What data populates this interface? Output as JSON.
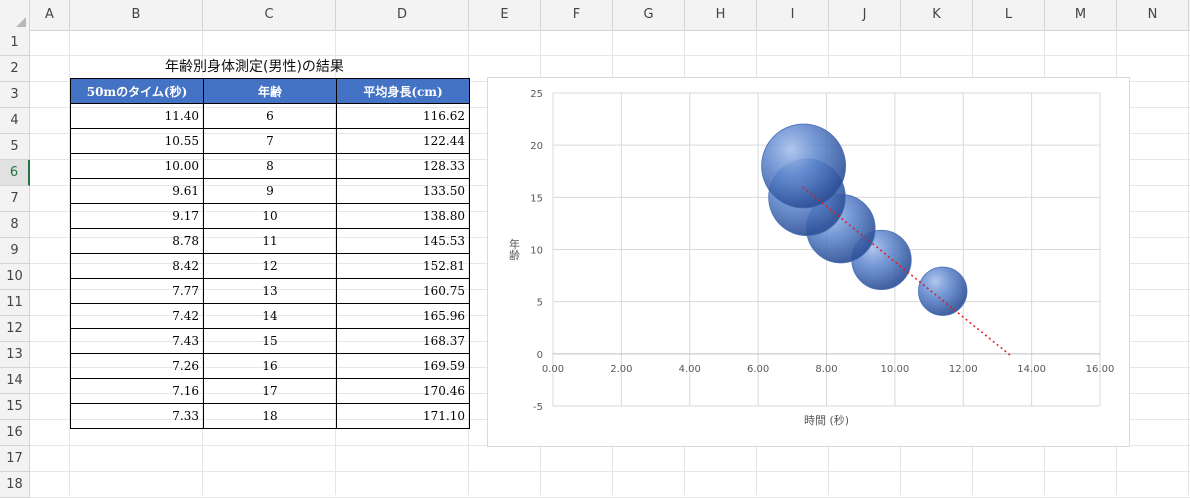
{
  "sheet": {
    "columns": [
      "A",
      "B",
      "C",
      "D",
      "E",
      "F",
      "G",
      "H",
      "I",
      "J",
      "K",
      "L",
      "M",
      "N"
    ],
    "rows": [
      "1",
      "2",
      "3",
      "4",
      "5",
      "6",
      "7",
      "8",
      "9",
      "10",
      "11",
      "12",
      "13",
      "14",
      "15",
      "16",
      "17",
      "18"
    ],
    "selected_row": "6"
  },
  "table": {
    "title": "年齢別身体測定(男性)の結果",
    "headers": [
      "50mのタイム(秒)",
      "年齢",
      "平均身長(cm)"
    ],
    "rows": [
      {
        "time": "11.40",
        "age": "6",
        "height": "116.62"
      },
      {
        "time": "10.55",
        "age": "7",
        "height": "122.44"
      },
      {
        "time": "10.00",
        "age": "8",
        "height": "128.33"
      },
      {
        "time": "9.61",
        "age": "9",
        "height": "133.50"
      },
      {
        "time": "9.17",
        "age": "10",
        "height": "138.80"
      },
      {
        "time": "8.78",
        "age": "11",
        "height": "145.53"
      },
      {
        "time": "8.42",
        "age": "12",
        "height": "152.81"
      },
      {
        "time": "7.77",
        "age": "13",
        "height": "160.75"
      },
      {
        "time": "7.42",
        "age": "14",
        "height": "165.96"
      },
      {
        "time": "7.43",
        "age": "15",
        "height": "168.37"
      },
      {
        "time": "7.26",
        "age": "16",
        "height": "169.59"
      },
      {
        "time": "7.16",
        "age": "17",
        "height": "170.46"
      },
      {
        "time": "7.33",
        "age": "18",
        "height": "171.10"
      }
    ]
  },
  "chart_data": {
    "type": "scatter",
    "subtype": "bubble",
    "title": "",
    "xlabel": "時間 (秒)",
    "ylabel": "年齢",
    "xlim": [
      0,
      16
    ],
    "ylim": [
      -5,
      25
    ],
    "xticks": [
      "0.00",
      "2.00",
      "4.00",
      "6.00",
      "8.00",
      "10.00",
      "12.00",
      "14.00",
      "16.00"
    ],
    "yticks": [
      "25",
      "20",
      "15",
      "10",
      "5",
      "0",
      "-5"
    ],
    "grid": true,
    "bubble_color": "#4472c4",
    "trendline": {
      "type": "linear",
      "color": "#e31a1c",
      "style": "dotted",
      "x": [
        7.3,
        13.4
      ],
      "y": [
        16.0,
        -0.2
      ]
    },
    "series": [
      {
        "points": [
          {
            "x": 11.4,
            "y": 6,
            "size": 6
          },
          {
            "x": 9.61,
            "y": 9,
            "size": 9
          },
          {
            "x": 8.42,
            "y": 12,
            "size": 12
          },
          {
            "x": 7.43,
            "y": 15,
            "size": 15
          },
          {
            "x": 7.33,
            "y": 18,
            "size": 18
          }
        ]
      }
    ]
  }
}
